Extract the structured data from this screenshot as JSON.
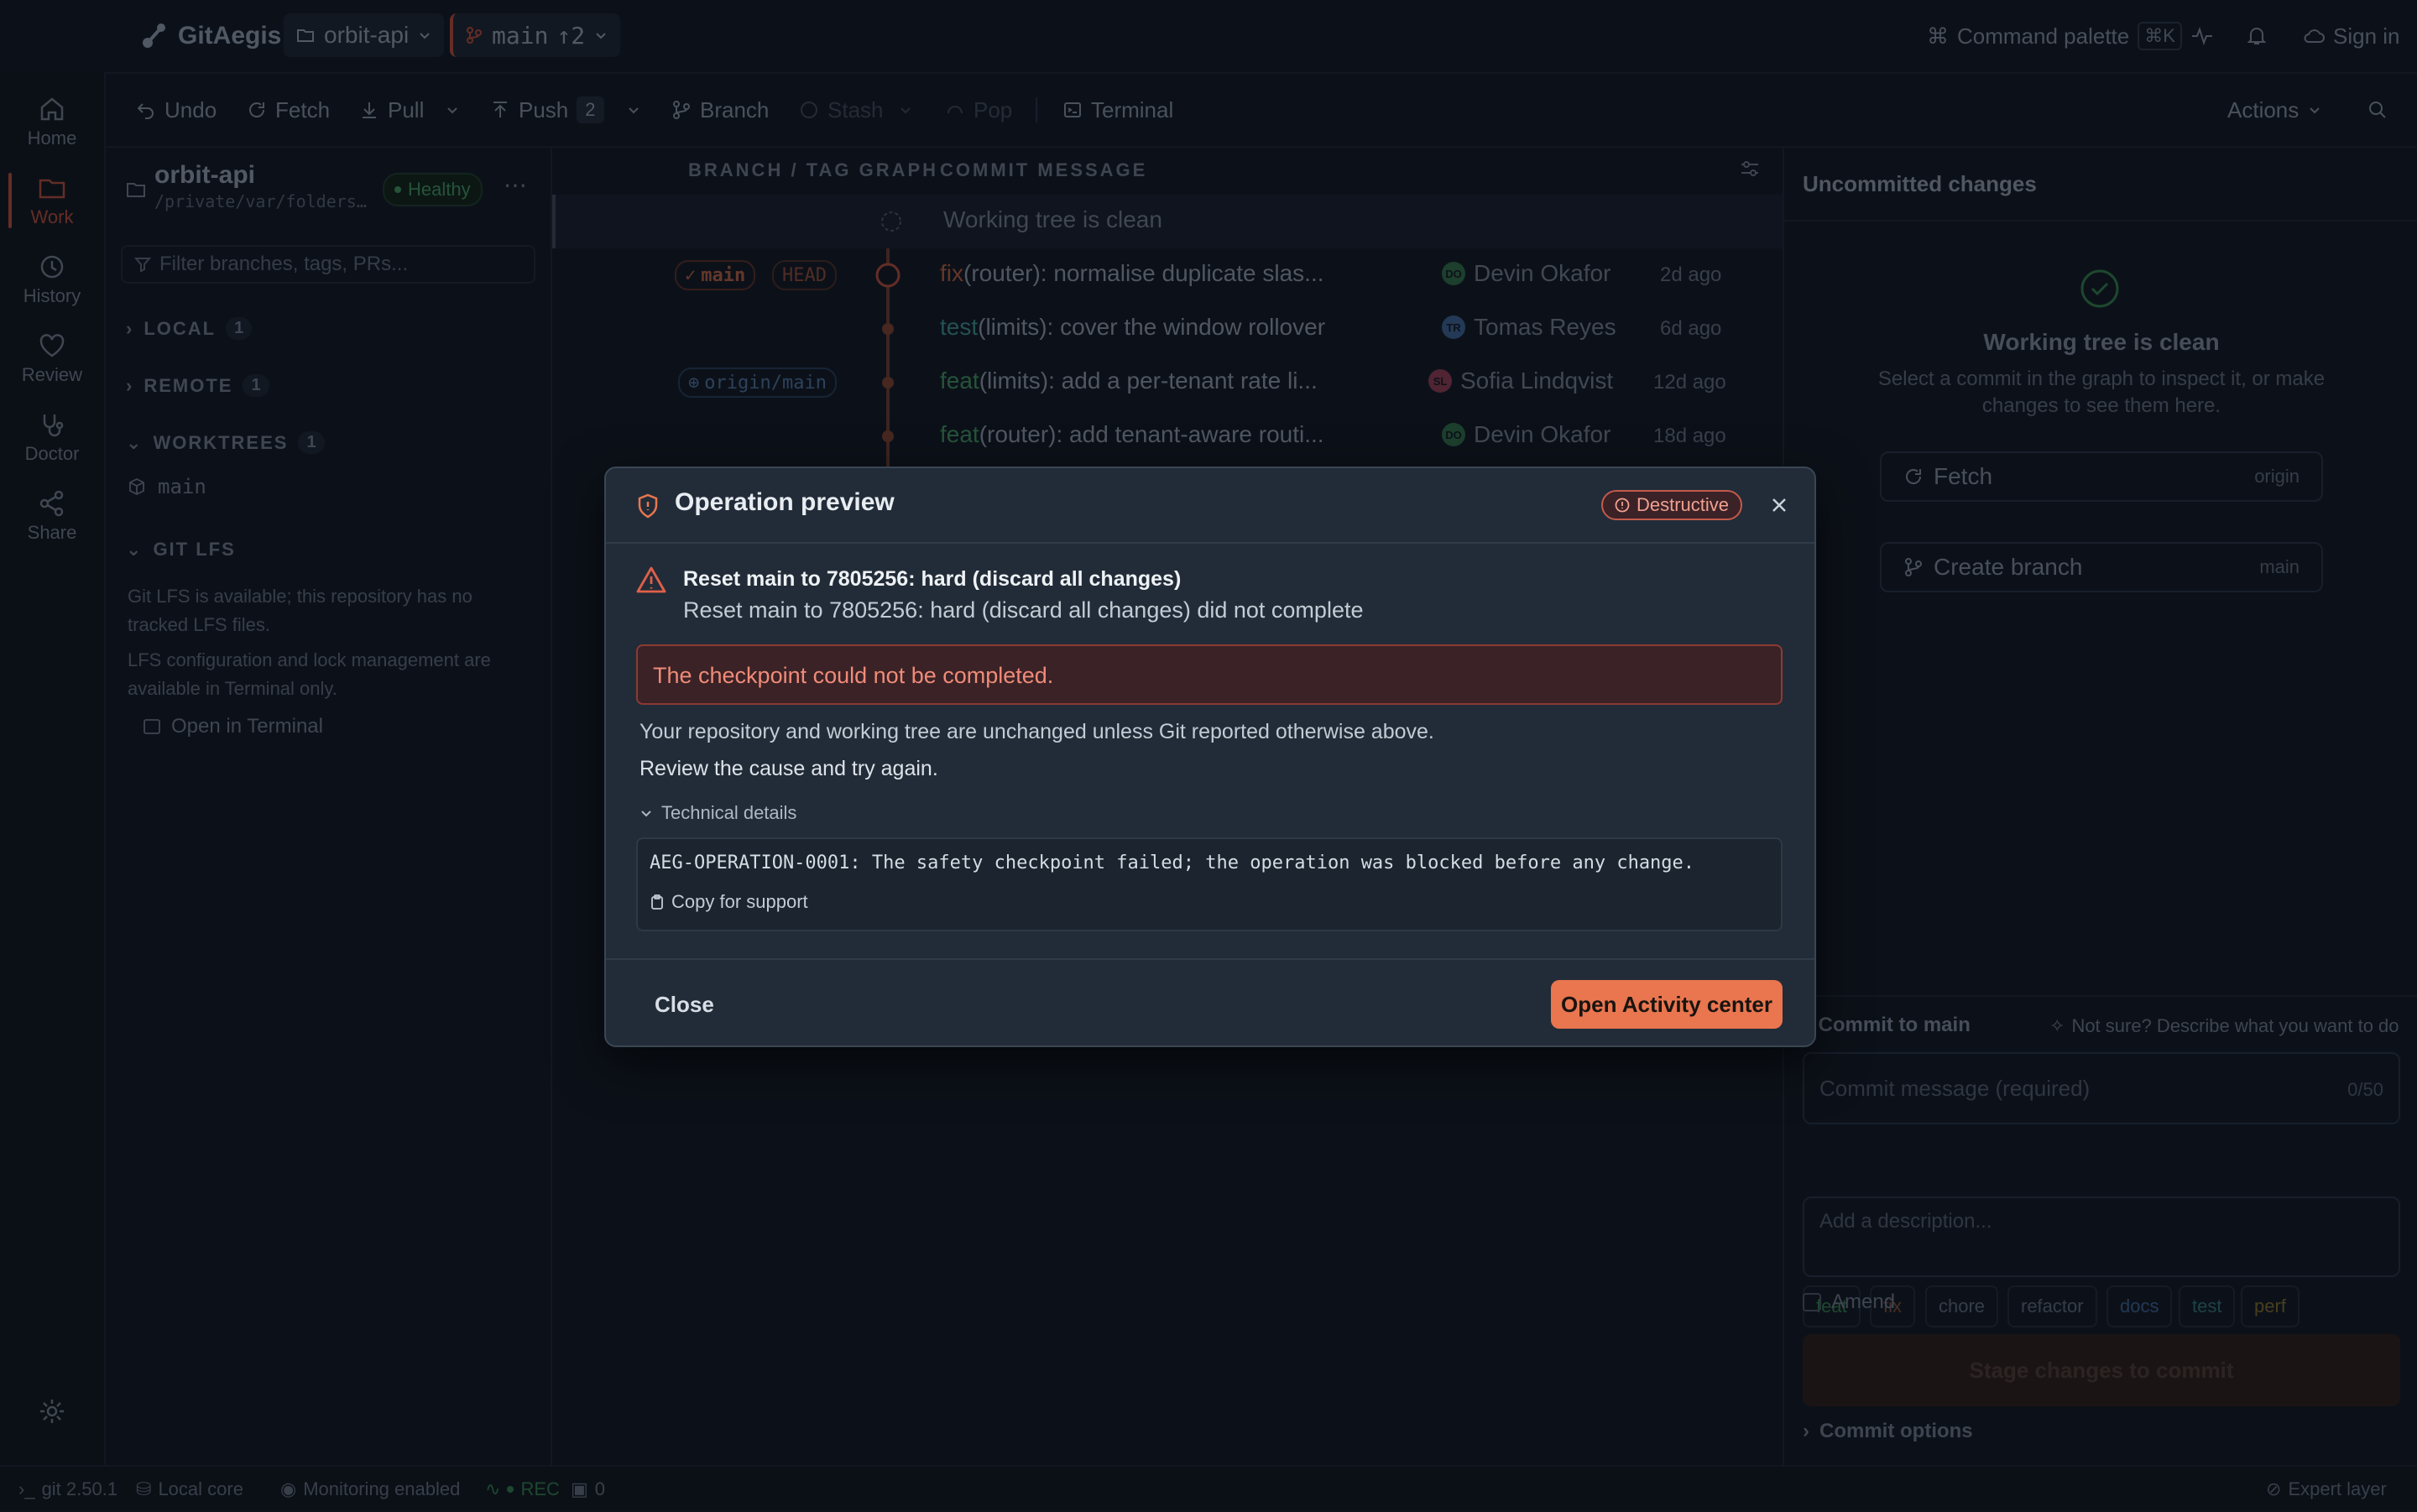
{
  "app": {
    "name": "GitAegis"
  },
  "topbar": {
    "repo": "orbit-api",
    "branch": "main",
    "ahead": "↑2",
    "command_palette": "Command palette",
    "shortcut": "⌘K",
    "sign_in": "Sign in"
  },
  "rail": {
    "items": [
      {
        "label": "Home"
      },
      {
        "label": "Work"
      },
      {
        "label": "History"
      },
      {
        "label": "Review"
      },
      {
        "label": "Doctor"
      },
      {
        "label": "Share"
      }
    ]
  },
  "toolbar": {
    "undo": "Undo",
    "fetch": "Fetch",
    "pull": "Pull",
    "push": "Push",
    "push_count": "2",
    "branch": "Branch",
    "stash": "Stash",
    "pop": "Pop",
    "terminal": "Terminal",
    "actions": "Actions"
  },
  "sidebar": {
    "repo_name": "orbit-api",
    "repo_path": "/private/var/folders…",
    "health": "Healthy",
    "filter_placeholder": "Filter branches, tags, PRs...",
    "local": {
      "label": "LOCAL",
      "count": "1"
    },
    "remote": {
      "label": "REMOTE",
      "count": "1"
    },
    "worktrees": {
      "label": "WORKTREES",
      "count": "1",
      "items": [
        "main"
      ]
    },
    "lfs": {
      "label": "GIT LFS",
      "text1": "Git LFS is available; this repository has no tracked LFS files.",
      "text2": "LFS configuration and lock management are available in Terminal only.",
      "open_terminal": "Open in Terminal"
    }
  },
  "graph": {
    "col_graph": "BRANCH / TAG GRAPH",
    "col_message": "COMMIT MESSAGE",
    "working_tree": "Working tree is clean",
    "commits": [
      {
        "type": "fix",
        "rest": "(router): normalise duplicate slas...",
        "author": "Devin Okafor",
        "initials": "DO",
        "age": "2d ago",
        "refs": [
          "main",
          "HEAD"
        ]
      },
      {
        "type": "test",
        "rest": "(limits): cover the window rollover",
        "author": "Tomas Reyes",
        "initials": "TR",
        "age": "6d ago",
        "refs": []
      },
      {
        "type": "feat",
        "rest": "(limits): add a per-tenant rate li...",
        "author": "Sofia Lindqvist",
        "initials": "SL",
        "age": "12d ago",
        "refs": [
          "origin/main"
        ]
      },
      {
        "type": "feat",
        "rest": "(router): add tenant-aware routi...",
        "author": "Devin Okafor",
        "initials": "DO",
        "age": "18d ago",
        "refs": []
      }
    ]
  },
  "right": {
    "title": "Uncommitted changes",
    "clean_title": "Working tree is clean",
    "clean_text": "Select a commit in the graph to inspect it, or make changes to see them here.",
    "fetch": "Fetch",
    "fetch_hint": "origin",
    "create_branch": "Create branch",
    "create_hint": "main",
    "commit_to": "Commit to main",
    "not_sure": "Not sure? Describe what you want to do",
    "message_placeholder": "Commit message (required)",
    "counter": "0/50",
    "chips": [
      "feat",
      "fix",
      "chore",
      "refactor",
      "docs",
      "test",
      "perf"
    ],
    "description_placeholder": "Add a description...",
    "amend": "Amend",
    "stage": "Stage changes to commit",
    "commit_options": "Commit options"
  },
  "status": {
    "git": "git 2.50.1",
    "core": "Local core",
    "monitoring": "Monitoring enabled",
    "rec": "REC",
    "count": "0",
    "expert": "Expert layer"
  },
  "modal": {
    "title": "Operation preview",
    "badge": "Destructive",
    "headline": "Reset main to 7805256: hard (discard all changes)",
    "subline": "Reset main to 7805256: hard (discard all changes) did not complete",
    "error": "The checkpoint could not be completed.",
    "info1": "Your repository and working tree are unchanged unless Git reported otherwise above.",
    "info2": "Review the cause and try again.",
    "details_label": "Technical details",
    "code": "AEG-OPERATION-0001: The safety checkpoint failed; the operation was blocked before any change.",
    "copy": "Copy for support",
    "close": "Close",
    "primary": "Open Activity center"
  },
  "colors": {
    "accent": "#e9764f",
    "danger": "#c25a4a",
    "feat": "#3f8f5c",
    "fix": "#b05c3f",
    "test": "#3b8a8a"
  }
}
